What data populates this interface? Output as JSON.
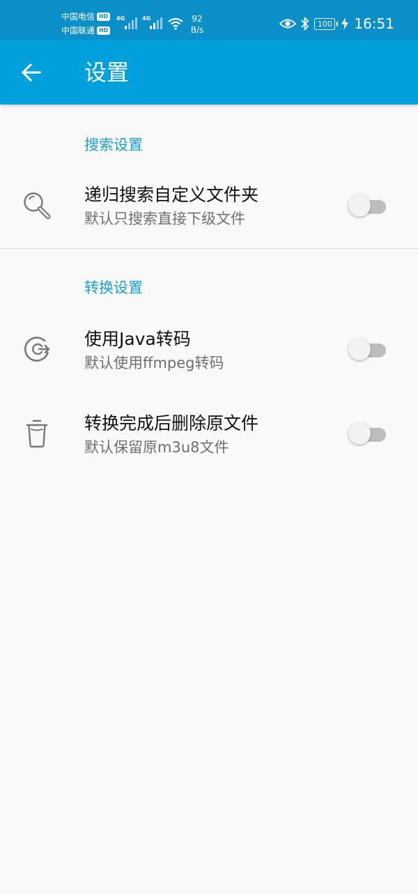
{
  "status_bar": {
    "carrier_1": "中国电信",
    "carrier_2": "中国联通",
    "hd_badge": "HD",
    "network_type_1": "4G",
    "network_type_2": "4G",
    "net_speed_value": "92",
    "net_speed_unit": "B/s",
    "battery": "100",
    "time": "16:51",
    "icons": [
      "signal-icon",
      "wifi-icon",
      "eye-icon",
      "bluetooth-icon",
      "battery-icon",
      "charging-icon"
    ]
  },
  "app_bar": {
    "title": "设置",
    "back_icon": "arrow-back-icon"
  },
  "sections": [
    {
      "header": "搜索设置",
      "items": [
        {
          "icon": "search-icon",
          "title": "递归搜索自定义文件夹",
          "summary": "默认只搜索直接下级文件",
          "enabled": false
        }
      ]
    },
    {
      "header": "转换设置",
      "items": [
        {
          "icon": "convert-icon",
          "title": "使用Java转码",
          "summary": "默认使用ffmpeg转码",
          "enabled": false
        },
        {
          "icon": "trash-icon",
          "title": "转换完成后删除原文件",
          "summary": "默认保留原m3u8文件",
          "enabled": false
        }
      ]
    }
  ],
  "colors": {
    "status_bar": "#0b8fc9",
    "app_bar": "#00a0dd",
    "accent": "#1a9fd6",
    "background": "#f9f9f9"
  }
}
